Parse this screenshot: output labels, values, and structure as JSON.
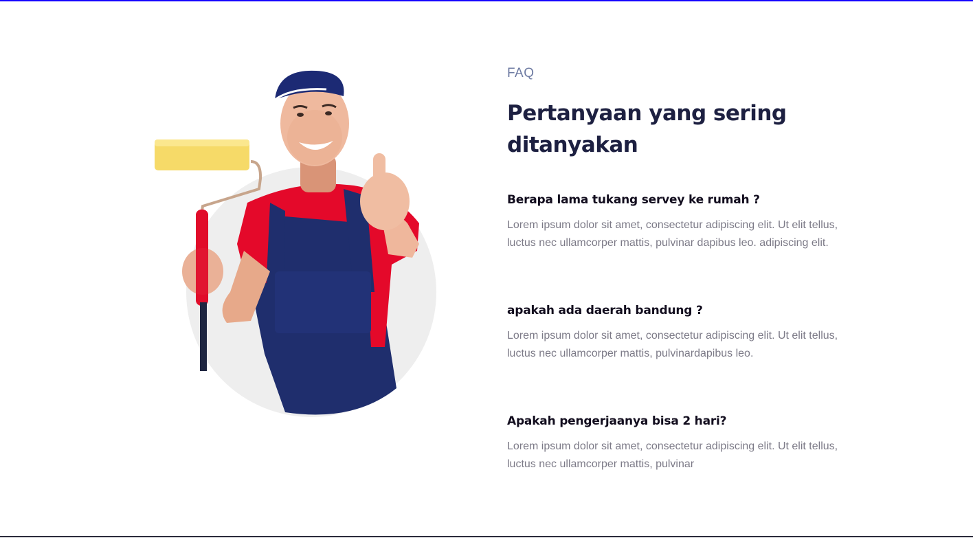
{
  "colors": {
    "top_border": "#1400ff",
    "eyebrow": "#6f7ca3",
    "title": "#1d2041",
    "question": "#120d1e",
    "answer": "#7c7a87",
    "circle_bg": "#eeeeee"
  },
  "hero": {
    "image": "painter-thumbs-up-illustration"
  },
  "faq": {
    "eyebrow": "FAQ",
    "title_line1": "Pertanyaan yang sering",
    "title_line2": "ditanyakan",
    "items": [
      {
        "question": "Berapa lama tukang servey ke rumah ?",
        "answer_line1": "Lorem ipsum dolor sit amet, consectetur adipiscing elit. Ut elit tellus,",
        "answer_line2": "luctus nec ullamcorper mattis, pulvinar dapibus leo. adipiscing elit."
      },
      {
        "question": "apakah ada daerah bandung ?",
        "answer_line1": "Lorem ipsum dolor sit amet, consectetur adipiscing elit. Ut elit tellus,",
        "answer_line2": "luctus nec ullamcorper mattis, pulvinardapibus leo."
      },
      {
        "question": "Apakah pengerjaanya bisa 2 hari?",
        "answer_line1": "Lorem ipsum dolor sit amet, consectetur adipiscing elit. Ut elit tellus,",
        "answer_line2": "luctus nec ullamcorper mattis, pulvinar"
      }
    ]
  }
}
